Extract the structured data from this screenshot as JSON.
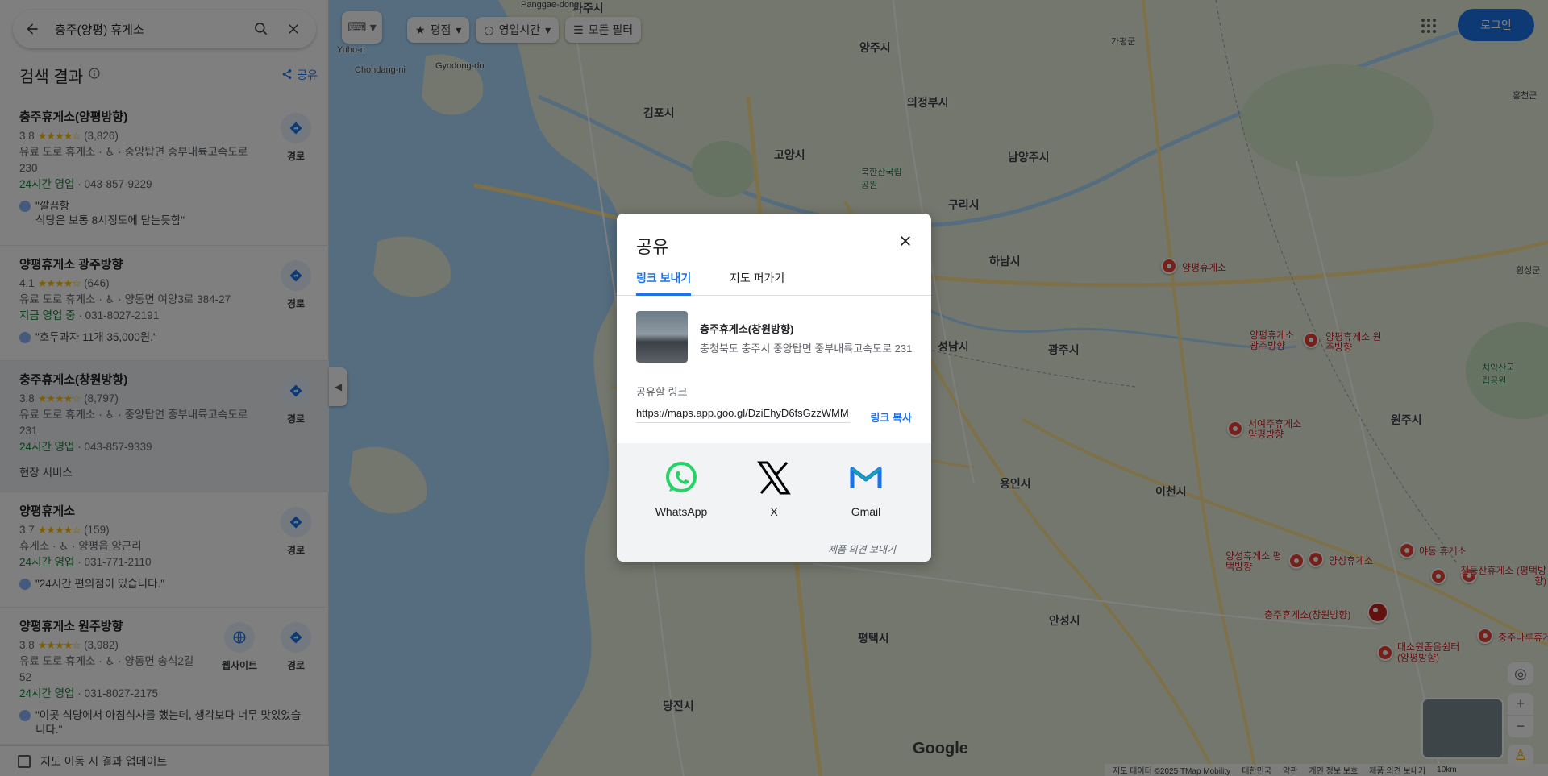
{
  "search": {
    "query": "충주(양평) 휴게소"
  },
  "results_header": {
    "title": "검색 결과",
    "share_label": "공유"
  },
  "results": [
    {
      "name": "충주휴게소(양평방향)",
      "rating": "3.8",
      "stars": "★★★★☆",
      "count": "(3,826)",
      "category_line": "유료 도로 휴게소 · ♿ · 중앙탑면 중부내륙고속도로 230",
      "status": "24시간 영업",
      "phone": "· 043-857-9229",
      "review": "\"깔끔항\n식당은 보통 8시정도에 닫는듯함\"",
      "action_label": "경로"
    },
    {
      "name": "양평휴게소 광주방향",
      "rating": "4.1",
      "stars": "★★★★☆",
      "count": "(646)",
      "category_line": "유료 도로 휴게소 · ♿ · 양동면 여양3로 384-27",
      "status": "지금 영업 중",
      "phone": "· 031-8027-2191",
      "review": "\"호두과자 11개 35,000원.\"",
      "action_label": "경로"
    },
    {
      "name": "충주휴게소(창원방향)",
      "rating": "3.8",
      "stars": "★★★★☆",
      "count": "(8,797)",
      "category_line": "유료 도로 휴게소 · ♿ · 중앙탑면 중부내륙고속도로 231",
      "status": "24시간 영업",
      "phone": "· 043-857-9339",
      "extra": "현장 서비스",
      "action_label": "경로"
    },
    {
      "name": "양평휴게소",
      "rating": "3.7",
      "stars": "★★★★☆",
      "count": "(159)",
      "category_line": "휴게소 · ♿ · 양평읍 양근리",
      "status": "24시간 영업",
      "phone": "· 031-771-2110",
      "review": "\"24시간 편의점이 있습니다.\"",
      "action_label": "경로"
    },
    {
      "name": "양평휴게소 원주방향",
      "rating": "3.8",
      "stars": "★★★★☆",
      "count": "(3,982)",
      "category_line": "유료 도로 휴게소 · ♿ · 양동면 송석2길 52",
      "status": "24시간 영업",
      "phone": "· 031-8027-2175",
      "review": "\"이곳 식당에서 아침식사를 했는데, 생각보다 너무 맛있었습니다.\"",
      "website_label": "웹사이트",
      "action_label": "경로"
    }
  ],
  "update_bar": {
    "label": "지도 이동 시 결과 업데이트"
  },
  "filters": {
    "rating": "평점",
    "hours": "영업시간",
    "all": "모든 필터"
  },
  "header": {
    "login": "로그인"
  },
  "map": {
    "cities": [
      "파주시",
      "양주시",
      "의정부시",
      "김포시",
      "고양시",
      "남양주시",
      "구리시",
      "하남시",
      "성남시",
      "광주시",
      "용인시",
      "이천시",
      "안성시",
      "평택시",
      "당진시",
      "원주시",
      "북한산국립공원",
      "가평군",
      "횡성군",
      "치악산국립공원",
      "Panggae-dong",
      "Yuho-ri",
      "Chondang-ni",
      "Gyodong-do",
      "홍천군"
    ],
    "pois": [
      "양평휴게소",
      "양평휴게소 광주방향",
      "양평휴게소 원주방향",
      "서여주휴게소 양평방향",
      "양성휴게소",
      "양성휴게소 평택방향",
      "야동 휴게소",
      "천등산휴게소 (평택방향)",
      "충주휴게소(창원방향)",
      "대소원졸음쉼터(양평방향)",
      "충주나루휴게"
    ],
    "logo": "Google",
    "footer": [
      "지도 데이터 ©2025 TMap Mobility",
      "대한민국",
      "약관",
      "개인 정보 보호",
      "제품 의견 보내기",
      "10km"
    ]
  },
  "dialog": {
    "title": "공유",
    "tabs": [
      "링크 보내기",
      "지도 퍼가기"
    ],
    "place_name": "충주휴게소(창원방향)",
    "place_address": "충청북도 충주시 중앙탑면 중부내륙고속도로 231",
    "link_label": "공유할 링크",
    "link_value": "https://maps.app.goo.gl/DziEhyD6fsGzzWMM",
    "copy_label": "링크 복사",
    "apps": [
      "WhatsApp",
      "X",
      "Gmail"
    ],
    "feedback": "제품 의견 보내기"
  },
  "colors": {
    "accent": "#1a73e8",
    "open_green": "#188038",
    "star": "#fbbc04",
    "pin_red": "#ea4335",
    "whatsapp": "#25d366",
    "gmail": "#1a73e8"
  }
}
